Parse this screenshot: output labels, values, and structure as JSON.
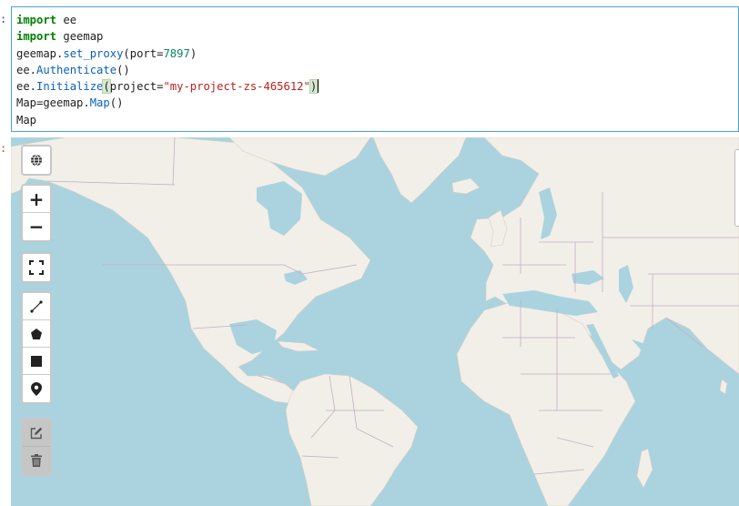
{
  "notebook": {
    "input_prompt": ":",
    "output_prompt": ":"
  },
  "code": {
    "line1": {
      "keyword": "import",
      "module": " ee"
    },
    "line2": {
      "keyword": "import",
      "module": " geemap"
    },
    "line3": {
      "obj": "geemap.",
      "method": "set_proxy",
      "open": "(port=",
      "number": "7897",
      "close": ")"
    },
    "line4": {
      "obj": "ee.",
      "method": "Authenticate",
      "rest": "()"
    },
    "line5": {
      "obj": "ee.",
      "method": "Initialize",
      "open": "(",
      "arg": "project=",
      "string": "\"my-project-zs-465612\"",
      "close": ")"
    },
    "line6": {
      "lhs": "Map=geemap.",
      "method": "Map",
      "rest": "()"
    },
    "line7": {
      "text": "Map"
    }
  },
  "map_controls": {
    "basemap": {
      "icon": "globe-icon"
    },
    "zoom_in": {
      "label": "+"
    },
    "zoom_out": {
      "label": "−"
    },
    "fullscreen": {
      "icon": "fullscreen-icon"
    },
    "draw_tools": [
      "polyline-icon",
      "polygon-icon",
      "rectangle-icon",
      "marker-icon"
    ],
    "edit_tools": [
      "edit-icon",
      "trash-icon"
    ]
  },
  "map_colors": {
    "water": "#aad3df",
    "land": "#f2efe9",
    "border": "#c2aec3"
  }
}
